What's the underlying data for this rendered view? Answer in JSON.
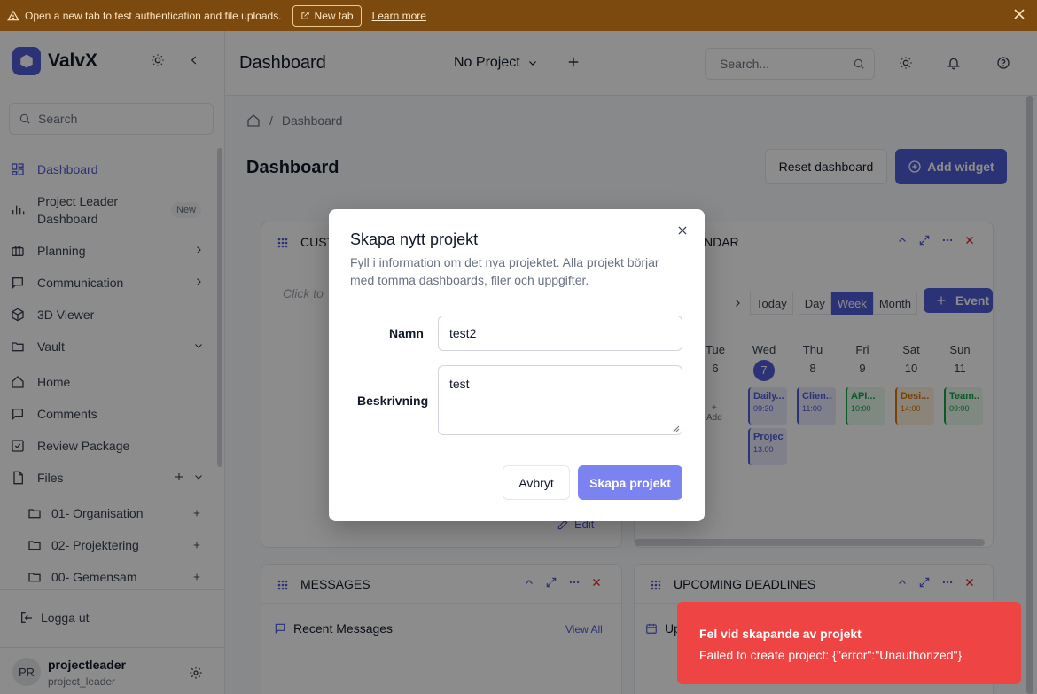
{
  "banner": {
    "text": "Open a new tab to test authentication and file uploads.",
    "new_tab": "New tab",
    "learn_more": "Learn more"
  },
  "sidebar": {
    "brand": "ValvX",
    "search_placeholder": "Search",
    "items": [
      {
        "label": "Dashboard"
      },
      {
        "label": "Project Leader",
        "label2": "Dashboard",
        "badge": "New"
      },
      {
        "label": "Planning"
      },
      {
        "label": "Communication"
      },
      {
        "label": "3D Viewer"
      },
      {
        "label": "Vault"
      },
      {
        "label": "Home"
      },
      {
        "label": "Comments"
      },
      {
        "label": "Review Package"
      },
      {
        "label": "Files"
      },
      {
        "label": "01- Organisation"
      },
      {
        "label": "02- Projektering"
      },
      {
        "label": "00- Gemensam"
      }
    ],
    "logout": "Logga ut",
    "user": {
      "initials": "PR",
      "name": "projectleader",
      "role": "project_leader"
    }
  },
  "header": {
    "title": "Dashboard",
    "project": "No Project",
    "search_placeholder": "Search..."
  },
  "main": {
    "breadcrumb": [
      "Dashboard"
    ],
    "title": "Dashboard",
    "reset": "Reset dashboard",
    "add_widget": "Add widget"
  },
  "widgets": {
    "custom": {
      "title": "CUST",
      "hint": "Click to",
      "edit": "Edit"
    },
    "calendar": {
      "title": "NDAR",
      "buttons": [
        "Today",
        "Day",
        "Week",
        "Month"
      ],
      "selected": "Week",
      "event": "Event",
      "days": [
        {
          "name": "Tue",
          "num": "6"
        },
        {
          "name": "Wed",
          "num": "7"
        },
        {
          "name": "Thu",
          "num": "8"
        },
        {
          "name": "Fri",
          "num": "9"
        },
        {
          "name": "Sat",
          "num": "10"
        },
        {
          "name": "Sun",
          "num": "11"
        }
      ],
      "events": [
        {
          "title": "Daily...",
          "time": "09:30",
          "color": "#4f5bd5",
          "bg": "#e8eafc"
        },
        {
          "title": "Clien...",
          "time": "11:00",
          "color": "#4f5bd5",
          "bg": "#e8eafc"
        },
        {
          "title": "API...",
          "time": "10:00",
          "color": "#16a34a",
          "bg": "#e7f7ec"
        },
        {
          "title": "Desi...",
          "time": "14:00",
          "color": "#d97706",
          "bg": "#fdf1dc"
        },
        {
          "title": "Team...",
          "time": "09:00",
          "color": "#16a34a",
          "bg": "#e7f7ec"
        },
        {
          "title": "Project",
          "time": "13:00",
          "color": "#4f5bd5",
          "bg": "#e8eafc"
        }
      ],
      "add": "Add"
    },
    "messages": {
      "title": "MESSAGES",
      "recent": "Recent Messages",
      "view_all": "View All"
    },
    "deadlines": {
      "title": "UPCOMING DEADLINES",
      "sub": "Up"
    }
  },
  "modal": {
    "title": "Skapa nytt projekt",
    "description": "Fyll i information om det nya projektet. Alla projekt börjar med tomma dashboards, filer och uppgifter.",
    "name_label": "Namn",
    "name_value": "test2",
    "desc_label": "Beskrivning",
    "desc_value": "test",
    "cancel": "Avbryt",
    "create": "Skapa projekt"
  },
  "toast": {
    "title": "Fel vid skapande av projekt",
    "message": "Failed to create project: {\"error\":\"Unauthorized\"}"
  },
  "colors": {
    "accent": "#4f5bd5",
    "error": "#ef4444",
    "banner": "#7c4a0e"
  }
}
